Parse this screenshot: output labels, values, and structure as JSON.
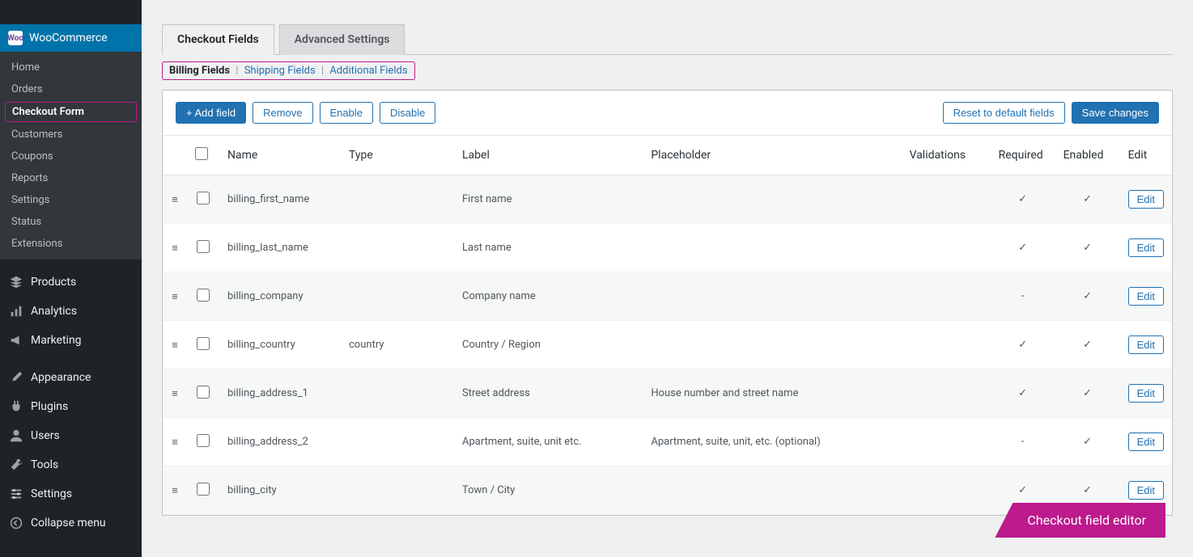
{
  "sidebar": {
    "active_parent_label": "WooCommerce",
    "active_parent_badge": "Woo",
    "sub_items": [
      "Home",
      "Orders",
      "Checkout Form",
      "Customers",
      "Coupons",
      "Reports",
      "Settings",
      "Status",
      "Extensions"
    ],
    "active_sub": "Checkout Form",
    "main_items": [
      {
        "icon": "products",
        "label": "Products"
      },
      {
        "icon": "analytics",
        "label": "Analytics"
      },
      {
        "icon": "marketing",
        "label": "Marketing"
      }
    ],
    "lower_items": [
      {
        "icon": "appearance",
        "label": "Appearance"
      },
      {
        "icon": "plugins",
        "label": "Plugins"
      },
      {
        "icon": "users",
        "label": "Users"
      },
      {
        "icon": "tools",
        "label": "Tools"
      },
      {
        "icon": "settings",
        "label": "Settings"
      }
    ],
    "collapse_label": "Collapse menu"
  },
  "tabs": {
    "t1": "Checkout Fields",
    "t2": "Advanced Settings",
    "active": "Checkout Fields"
  },
  "section_tabs": {
    "s1": "Billing Fields",
    "s2": "Shipping Fields",
    "s3": "Additional Fields",
    "active": "Billing Fields"
  },
  "toolbar": {
    "add_label": "+ Add field",
    "remove_label": "Remove",
    "enable_label": "Enable",
    "disable_label": "Disable",
    "reset_label": "Reset to default fields",
    "save_label": "Save changes"
  },
  "columns": {
    "name": "Name",
    "type": "Type",
    "label": "Label",
    "placeholder": "Placeholder",
    "validations": "Validations",
    "required": "Required",
    "enabled": "Enabled",
    "edit": "Edit"
  },
  "edit_btn_label": "Edit",
  "rows": [
    {
      "name": "billing_first_name",
      "type": "",
      "label": "First name",
      "placeholder": "",
      "required": true,
      "enabled": true
    },
    {
      "name": "billing_last_name",
      "type": "",
      "label": "Last name",
      "placeholder": "",
      "required": true,
      "enabled": true
    },
    {
      "name": "billing_company",
      "type": "",
      "label": "Company name",
      "placeholder": "",
      "required": false,
      "enabled": true
    },
    {
      "name": "billing_country",
      "type": "country",
      "label": "Country / Region",
      "placeholder": "",
      "required": true,
      "enabled": true
    },
    {
      "name": "billing_address_1",
      "type": "",
      "label": "Street address",
      "placeholder": "House number and street name",
      "required": true,
      "enabled": true
    },
    {
      "name": "billing_address_2",
      "type": "",
      "label": "Apartment, suite, unit etc.",
      "placeholder": "Apartment, suite, unit, etc. (optional)",
      "required": false,
      "enabled": true
    },
    {
      "name": "billing_city",
      "type": "",
      "label": "Town / City",
      "placeholder": "",
      "required": true,
      "enabled": true
    }
  ],
  "footer_badge": "Checkout field editor"
}
